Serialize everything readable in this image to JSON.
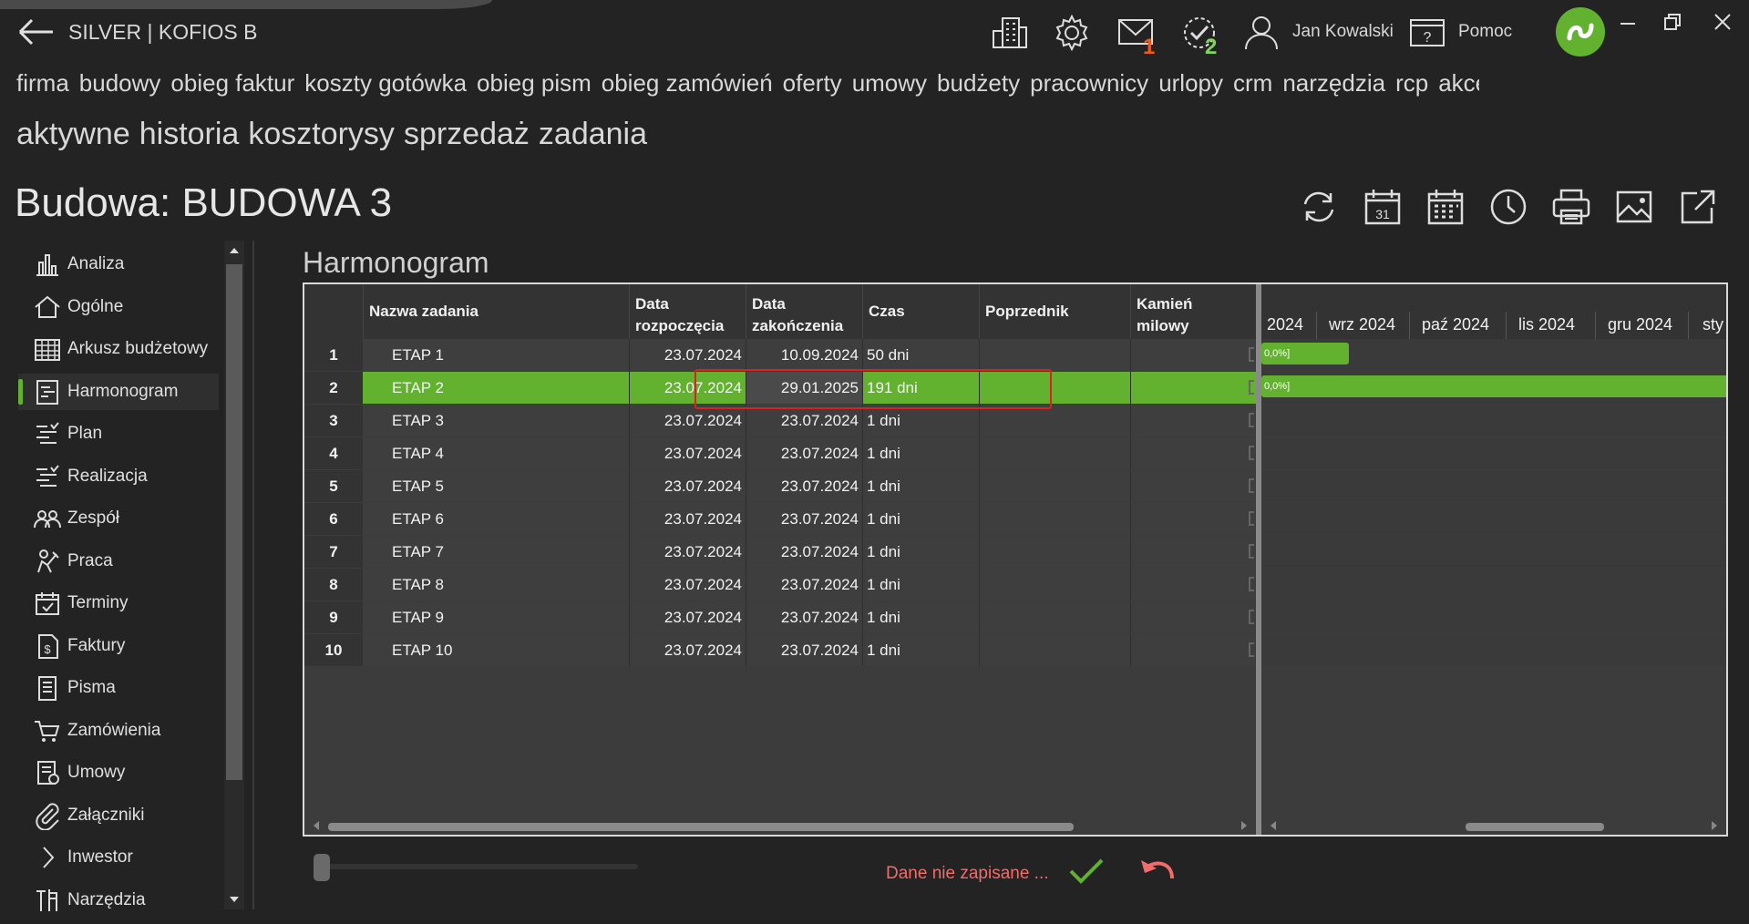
{
  "app": {
    "title": "SILVER | KOFIOS B",
    "user": "Jan Kowalski",
    "help": "Pomoc",
    "mail_badge": "1",
    "tasks_badge": "2"
  },
  "main_nav": [
    "firma",
    "budowy",
    "obieg faktur",
    "koszty gotówka",
    "obieg pism",
    "obieg zamówień",
    "oferty",
    "umowy",
    "budżety",
    "pracownicy",
    "urlopy",
    "crm",
    "narzędzia",
    "rcp",
    "akce"
  ],
  "sub_nav": [
    "aktywne",
    "historia",
    "kosztorysy",
    "sprzedaż",
    "zadania"
  ],
  "page_title": "Budowa: BUDOWA 3",
  "sidebar": [
    {
      "label": "Analiza",
      "icon": "bar-chart-icon"
    },
    {
      "label": "Ogólne",
      "icon": "home-icon"
    },
    {
      "label": "Arkusz budżetowy",
      "icon": "spreadsheet-icon"
    },
    {
      "label": "Harmonogram",
      "icon": "schedule-icon"
    },
    {
      "label": "Plan",
      "icon": "plan-list-icon"
    },
    {
      "label": "Realizacja",
      "icon": "checklist-icon"
    },
    {
      "label": "Zespół",
      "icon": "team-icon"
    },
    {
      "label": "Praca",
      "icon": "worker-icon"
    },
    {
      "label": "Terminy",
      "icon": "calendar-check-icon"
    },
    {
      "label": "Faktury",
      "icon": "invoice-icon"
    },
    {
      "label": "Pisma",
      "icon": "document-icon"
    },
    {
      "label": "Zamówienia",
      "icon": "cart-icon"
    },
    {
      "label": "Umowy",
      "icon": "contract-icon"
    },
    {
      "label": "Załączniki",
      "icon": "paperclip-icon"
    },
    {
      "label": "Inwestor",
      "icon": "chevron-right-icon"
    },
    {
      "label": "Narzędzia",
      "icon": "tools-icon"
    }
  ],
  "section_title": "Harmonogram",
  "table": {
    "headers": {
      "name": "Nazwa zadania",
      "start_1": "Data",
      "start_2": "rozpoczęcia",
      "end_1": "Data",
      "end_2": "zakończenia",
      "duration": "Czas",
      "predecessor": "Poprzednik",
      "milestone_1": "Kamień",
      "milestone_2": "milowy"
    },
    "rows": [
      {
        "num": "1",
        "name": "ETAP 1",
        "start": "23.07.2024",
        "end": "10.09.2024",
        "duration": "50 dni"
      },
      {
        "num": "2",
        "name": "ETAP 2",
        "start": "23.07.2024",
        "end": "29.01.2025",
        "duration": "191 dni"
      },
      {
        "num": "3",
        "name": "ETAP 3",
        "start": "23.07.2024",
        "end": "23.07.2024",
        "duration": "1 dni"
      },
      {
        "num": "4",
        "name": "ETAP 4",
        "start": "23.07.2024",
        "end": "23.07.2024",
        "duration": "1 dni"
      },
      {
        "num": "5",
        "name": "ETAP 5",
        "start": "23.07.2024",
        "end": "23.07.2024",
        "duration": "1 dni"
      },
      {
        "num": "6",
        "name": "ETAP 6",
        "start": "23.07.2024",
        "end": "23.07.2024",
        "duration": "1 dni"
      },
      {
        "num": "7",
        "name": "ETAP 7",
        "start": "23.07.2024",
        "end": "23.07.2024",
        "duration": "1 dni"
      },
      {
        "num": "8",
        "name": "ETAP 8",
        "start": "23.07.2024",
        "end": "23.07.2024",
        "duration": "1 dni"
      },
      {
        "num": "9",
        "name": "ETAP 9",
        "start": "23.07.2024",
        "end": "23.07.2024",
        "duration": "1 dni"
      },
      {
        "num": "10",
        "name": "ETAP 10",
        "start": "23.07.2024",
        "end": "23.07.2024",
        "duration": "1 dni"
      }
    ],
    "selected_row": "2"
  },
  "timeline": {
    "months": [
      "2024",
      "wrz 2024",
      "paź 2024",
      "lis 2024",
      "gru 2024",
      "sty"
    ],
    "bar_labels": [
      "0,0%]",
      "0,0%]"
    ]
  },
  "status": {
    "unsaved": "Dane nie zapisane ..."
  },
  "colors": {
    "accent": "#62b22f",
    "badge_mail": "#f05a1a",
    "badge_tasks": "#7fd45a",
    "warning_text": "#f26c6c",
    "selection_border": "#e02020"
  }
}
